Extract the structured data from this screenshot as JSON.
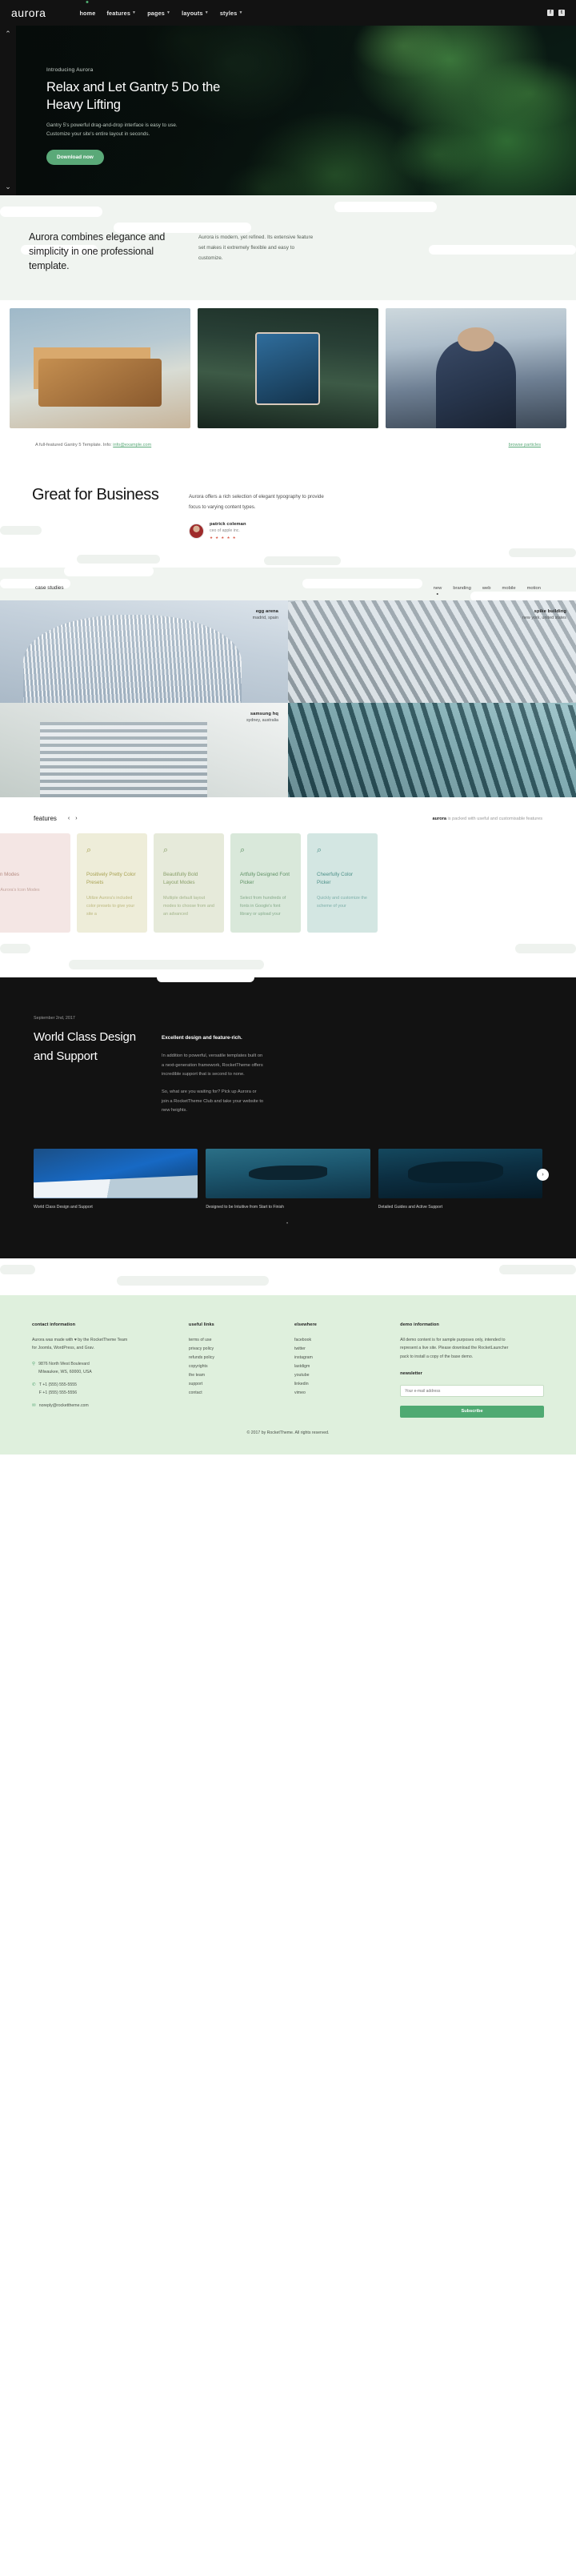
{
  "header": {
    "logo": "aurora",
    "nav": [
      {
        "label": "home",
        "caret": false,
        "active": true
      },
      {
        "label": "features",
        "caret": true,
        "active": false
      },
      {
        "label": "pages",
        "caret": true,
        "active": false
      },
      {
        "label": "layouts",
        "caret": true,
        "active": false
      },
      {
        "label": "styles",
        "caret": true,
        "active": false
      }
    ],
    "social": [
      {
        "name": "facebook-icon",
        "glyph": "f"
      },
      {
        "name": "twitter-icon",
        "glyph": "t"
      }
    ]
  },
  "hero": {
    "eyebrow": "Introducing Aurora",
    "title": "Relax and Let Gantry 5 Do the Heavy Lifting",
    "subtitle": "Gantry 5's powerful drag-and-drop interface is easy to use. Customize your site's entire layout in seconds.",
    "button": "Download now",
    "up_chevron": "⌃",
    "down_chevron": "⌄"
  },
  "intro": {
    "heading": "Aurora combines elegance and simplicity in one professional template.",
    "paragraph": "Aurora is modern, yet refined. Its extensive feature set makes it extremely flexible and easy to customize."
  },
  "infostrip": {
    "text_before": "A full-featured Gantry 5 Template. Info:",
    "email": "info@example.com",
    "right_link": "browse particles"
  },
  "business": {
    "heading": "Great for Business",
    "paragraph": "Aurora offers a rich selection of elegant typography to provide focus to varying content types.",
    "quote_name": "patrick coleman",
    "quote_role": "ceo of apple inc.",
    "stars": "★ ★ ★ ★ ★"
  },
  "case_studies": {
    "title": "case studies",
    "filters": [
      {
        "label": "new",
        "active": true
      },
      {
        "label": "branding",
        "active": false
      },
      {
        "label": "web",
        "active": false
      },
      {
        "label": "mobile",
        "active": false
      },
      {
        "label": "motion",
        "active": false
      }
    ],
    "items": [
      {
        "title": "egg arena",
        "location": "madrid, spain",
        "align": "tr"
      },
      {
        "title": "spike building",
        "location": "new york, united states",
        "align": "tr"
      },
      {
        "title": "samsung hq",
        "location": "sydney, australia",
        "align": "tr"
      },
      {
        "title": "",
        "location": "",
        "align": "tr"
      }
    ]
  },
  "features": {
    "title": "features",
    "prev": "‹",
    "next": "›",
    "note_brand": "aurora",
    "note_rest": " is packed with useful and customisable features",
    "cards": [
      {
        "icon": "search-icon",
        "glyph": "⌕",
        "title": "Intuitive Icon Modes",
        "body": "Pick the right Aurora's Icon Modes",
        "theme": "c-pink"
      },
      {
        "icon": "search-icon",
        "glyph": "⌕",
        "title": "Positively Pretty Color Presets",
        "body": "Utilize Aurora's included color presets to give your site a",
        "theme": "c-cream"
      },
      {
        "icon": "search-icon",
        "glyph": "⌕",
        "title": "Beautifully Bold Layout Modes",
        "body": "Multiple default layout modes to choose from and an advanced",
        "theme": "c-sage"
      },
      {
        "icon": "search-icon",
        "glyph": "⌕",
        "title": "Artfully Designed Font Picker",
        "body": "Select from hundreds of fonts in Google's font library or upload your",
        "theme": "c-mint"
      },
      {
        "icon": "search-icon",
        "glyph": "⌕",
        "title": "Cheerfully Color Picker",
        "body": "Quickly and customize the scheme of your",
        "theme": "c-aqua"
      }
    ]
  },
  "dark": {
    "date": "September 2nd, 2017",
    "heading": "World Class Design and Support",
    "subheading": "Excellent design and feature-rich.",
    "paragraph1": "In addition to powerful, versatile templates built on a next-generation framework, RocketTheme offers incredible support that is second to none.",
    "paragraph2": "So, what are you waiting for? Pick up Aurora or join a RocketTheme Club and take your website to new heights.",
    "next_arrow": "›",
    "dots": "•",
    "thumbs": [
      {
        "caption": "World Class Design and Support"
      },
      {
        "caption": "Designed to be Intuitive from Start to Finish"
      },
      {
        "caption": "Detailed Guides and Active Support"
      }
    ]
  },
  "footer": {
    "contact": {
      "heading": "contact information",
      "paragraph": "Aurora was made with ♥ by the RocketTheme Team for Joomla, WordPress, and Grav.",
      "pin_icon": "📍",
      "address": "9876 North West Boulevard\nMilwaukee, WS, 60000, USA",
      "phone_icon": "✆",
      "phone1": "T +1 (555) 555-5555",
      "phone2": "F +1 (555) 555-5556",
      "mail_icon": "✉",
      "email": "noreply@rockettheme.com"
    },
    "useful": {
      "heading": "useful links",
      "items": [
        "terms of use",
        "privacy policy",
        "refunds policy",
        "copyrights",
        "the team",
        "support",
        "contact"
      ]
    },
    "elsewhere": {
      "heading": "elsewhere",
      "items": [
        "facebook",
        "twitter",
        "instagram",
        "lastdigm",
        "youtube",
        "linkedin",
        "vimeo"
      ]
    },
    "demo": {
      "heading": "demo information",
      "paragraph": "All demo content is for sample purposes only, intended to represent a live site. Please download the RocketLauncher pack to install a copy of the base demo.",
      "newsletter_heading": "newsletter",
      "input_placeholder": "Your e-mail address",
      "button": "Subscribe"
    },
    "copyright": "© 2017 by RocketTheme. All rights reserved."
  }
}
